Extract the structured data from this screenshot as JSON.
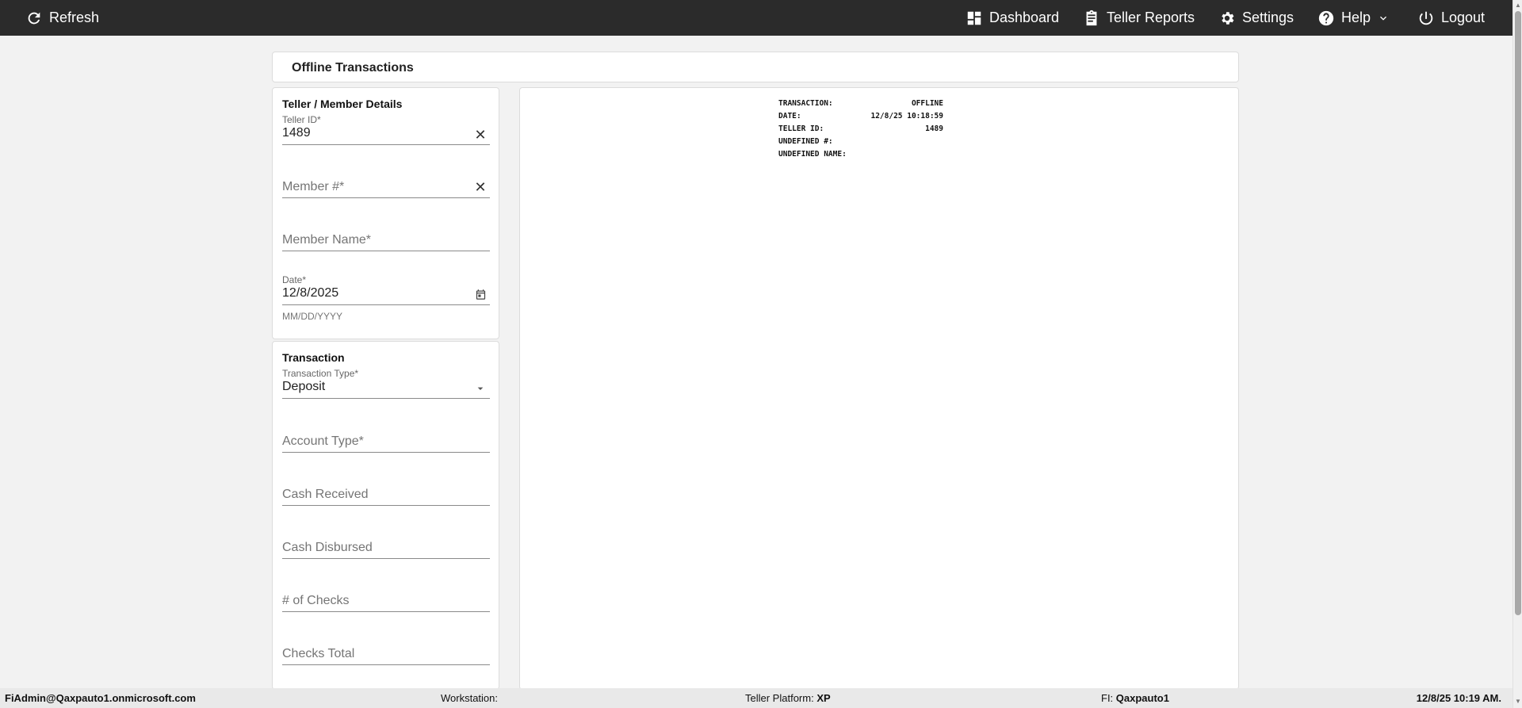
{
  "topbar": {
    "refresh_label": "Refresh",
    "dashboard_label": "Dashboard",
    "teller_reports_label": "Teller Reports",
    "settings_label": "Settings",
    "help_label": "Help",
    "logout_label": "Logout"
  },
  "page": {
    "title": "Offline Transactions"
  },
  "teller_card": {
    "title": "Teller / Member Details",
    "teller_id": {
      "label": "Teller ID*",
      "value": "1489"
    },
    "member_num": {
      "placeholder": "Member #*"
    },
    "member_name": {
      "placeholder": "Member Name*"
    },
    "date": {
      "label": "Date*",
      "value": "12/8/2025",
      "hint": "MM/DD/YYYY"
    }
  },
  "txn_card": {
    "title": "Transaction",
    "transaction_type": {
      "label": "Transaction Type*",
      "value": "Deposit"
    },
    "account_type": {
      "placeholder": "Account Type*"
    },
    "cash_received": {
      "placeholder": "Cash Received"
    },
    "cash_disbursed": {
      "placeholder": "Cash Disbursed"
    },
    "num_checks": {
      "placeholder": "# of Checks"
    },
    "checks_total": {
      "placeholder": "Checks Total"
    }
  },
  "receipt": {
    "rows": [
      {
        "key": "TRANSACTION:",
        "value": "OFFLINE"
      },
      {
        "key": "DATE:",
        "value": "12/8/25 10:18:59"
      },
      {
        "key": "TELLER ID:",
        "value": "1489"
      },
      {
        "key": "UNDEFINED #:",
        "value": ""
      },
      {
        "key": "UNDEFINED NAME:",
        "value": ""
      }
    ]
  },
  "footer": {
    "user": "FiAdmin@Qaxpauto1.onmicrosoft.com",
    "workstation_label": "Workstation:",
    "workstation_value": "",
    "platform_label": "Teller Platform:",
    "platform_value": "XP",
    "fi_label": "FI:",
    "fi_value": "Qaxpauto1",
    "datetime": "12/8/25 10:19 AM."
  },
  "icons": {
    "refresh": "refresh-icon",
    "dashboard": "dashboard-icon",
    "reports": "clipboard-icon",
    "settings": "gear-icon",
    "help": "help-icon",
    "logout": "power-icon"
  }
}
